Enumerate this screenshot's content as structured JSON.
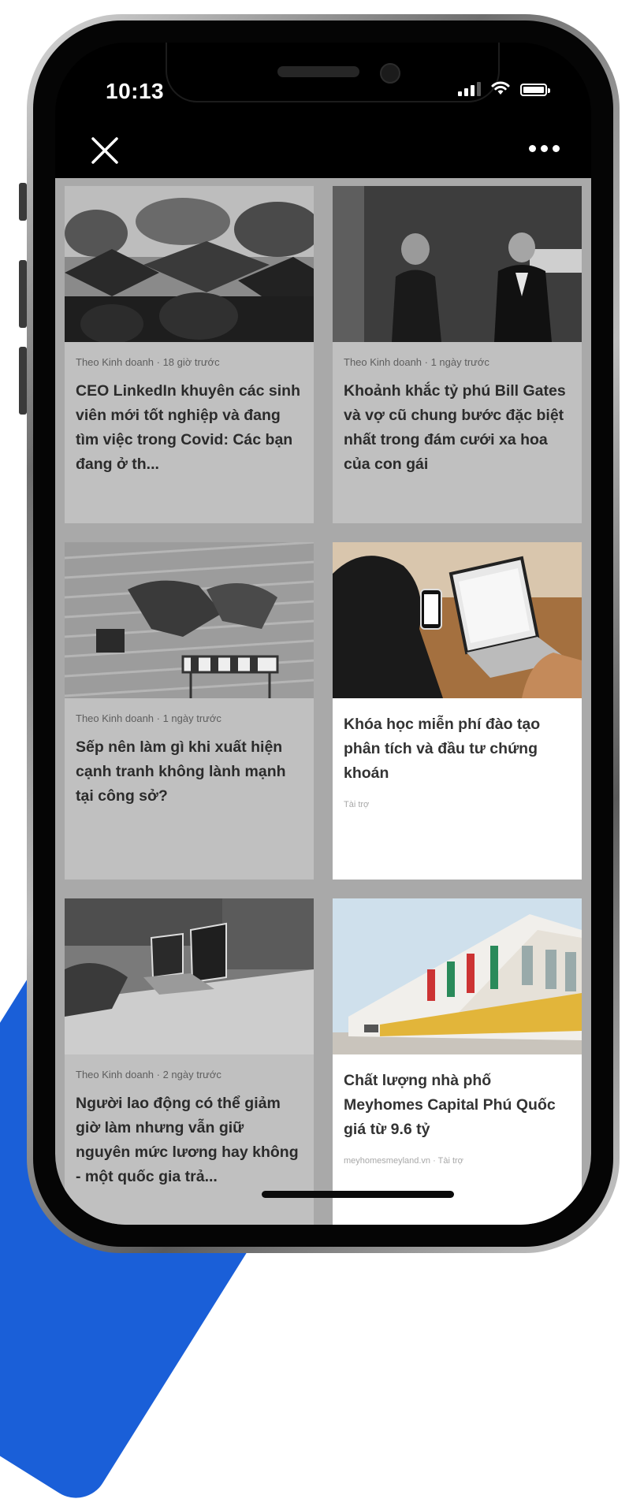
{
  "status_bar": {
    "time": "10:13"
  },
  "toolbar": {
    "close_icon": "close-icon",
    "more_icon": "more-horizontal-icon"
  },
  "cards": [
    {
      "source": "Theo Kinh doanh · 18 giờ trước",
      "title": "CEO LinkedIn khuyên các sinh viên mới tốt nghiệp và đang tìm việc trong Covid: Các bạn đang ở th..."
    },
    {
      "source": "Theo Kinh doanh · 1 ngày trước",
      "title": "Khoảnh khắc tỷ phú Bill Gates và vợ cũ chung bước đặc biệt nhất trong đám cưới xa hoa của con gái"
    },
    {
      "source": "Theo Kinh doanh · 1 ngày trước",
      "title": "Sếp nên làm gì khi xuất hiện cạnh tranh không lành mạnh tại công sở?"
    },
    {
      "title": "Khóa học miễn phí đào tạo phân tích và đầu tư chứng khoán",
      "ad_label": "Tài trợ"
    },
    {
      "source": "Theo Kinh doanh · 2 ngày trước",
      "title": "Người lao động có thể giảm giờ làm nhưng vẫn giữ nguyên mức lương hay không - một quốc gia trả..."
    },
    {
      "title": "Chất lượng nhà phố Meyhomes Capital Phú Quốc giá từ 9.6 tỷ",
      "ad_label": "meyhomesmeyland.vn · Tài trợ"
    }
  ],
  "colors": {
    "accent_blue": "#1a5fd8",
    "feed_background": "#a9a9a9",
    "card_background": "#c0c0c0"
  }
}
